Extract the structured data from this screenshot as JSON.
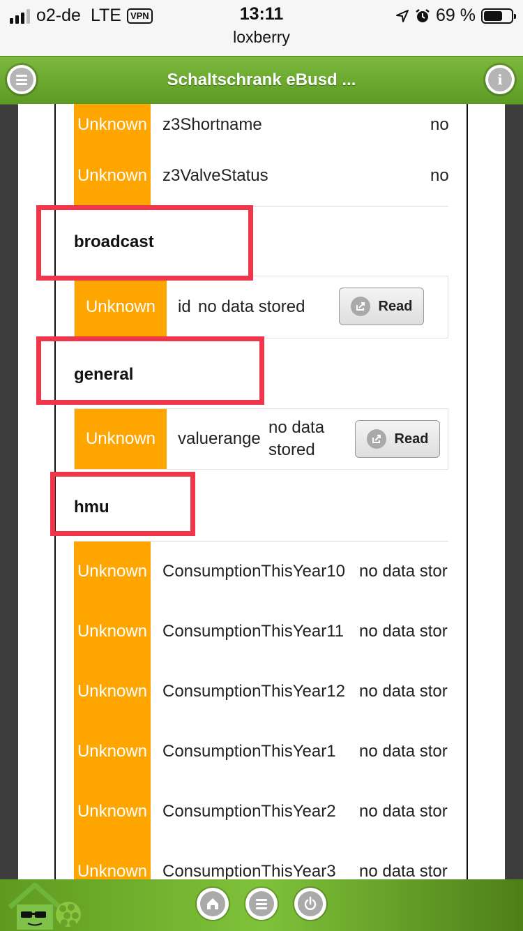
{
  "status_bar": {
    "carrier": "o2-de",
    "network": "LTE",
    "vpn": "VPN",
    "time": "13:11",
    "url": "loxberry",
    "battery": "69 %",
    "battery_level": 0.69
  },
  "header": {
    "title": "Schaltschrank eBusd ...",
    "menu_icon": "hamburger-menu-icon",
    "info_icon": "info-icon"
  },
  "top_rows": [
    {
      "status": "Unknown",
      "name": "z3Shortname",
      "value": "no"
    },
    {
      "status": "Unknown",
      "name": "z3ValveStatus",
      "value": "no"
    }
  ],
  "sections": {
    "broadcast": {
      "title": "broadcast",
      "row": {
        "status": "Unknown",
        "name": "id",
        "value": "no data stored",
        "button": "Read"
      }
    },
    "general": {
      "title": "general",
      "row": {
        "status": "Unknown",
        "name": "valuerange",
        "value_line1": "no data",
        "value_line2": "stored",
        "button": "Read"
      }
    },
    "hmu": {
      "title": "hmu",
      "rows": [
        {
          "status": "Unknown",
          "name": "ConsumptionThisYear10",
          "value": "no data stor"
        },
        {
          "status": "Unknown",
          "name": "ConsumptionThisYear11",
          "value": "no data stor"
        },
        {
          "status": "Unknown",
          "name": "ConsumptionThisYear12",
          "value": "no data stor"
        },
        {
          "status": "Unknown",
          "name": "ConsumptionThisYear1",
          "value": "no data stor"
        },
        {
          "status": "Unknown",
          "name": "ConsumptionThisYear2",
          "value": "no data stor"
        },
        {
          "status": "Unknown",
          "name": "ConsumptionThisYear3",
          "value": "no data stor"
        }
      ]
    }
  },
  "colors": {
    "accent_green": "#6aaa2c",
    "status_unknown": "#ffa500",
    "highlight_red": "#f0364b"
  },
  "footer": {
    "icons": [
      "home-icon",
      "menu-icon",
      "power-icon"
    ]
  }
}
